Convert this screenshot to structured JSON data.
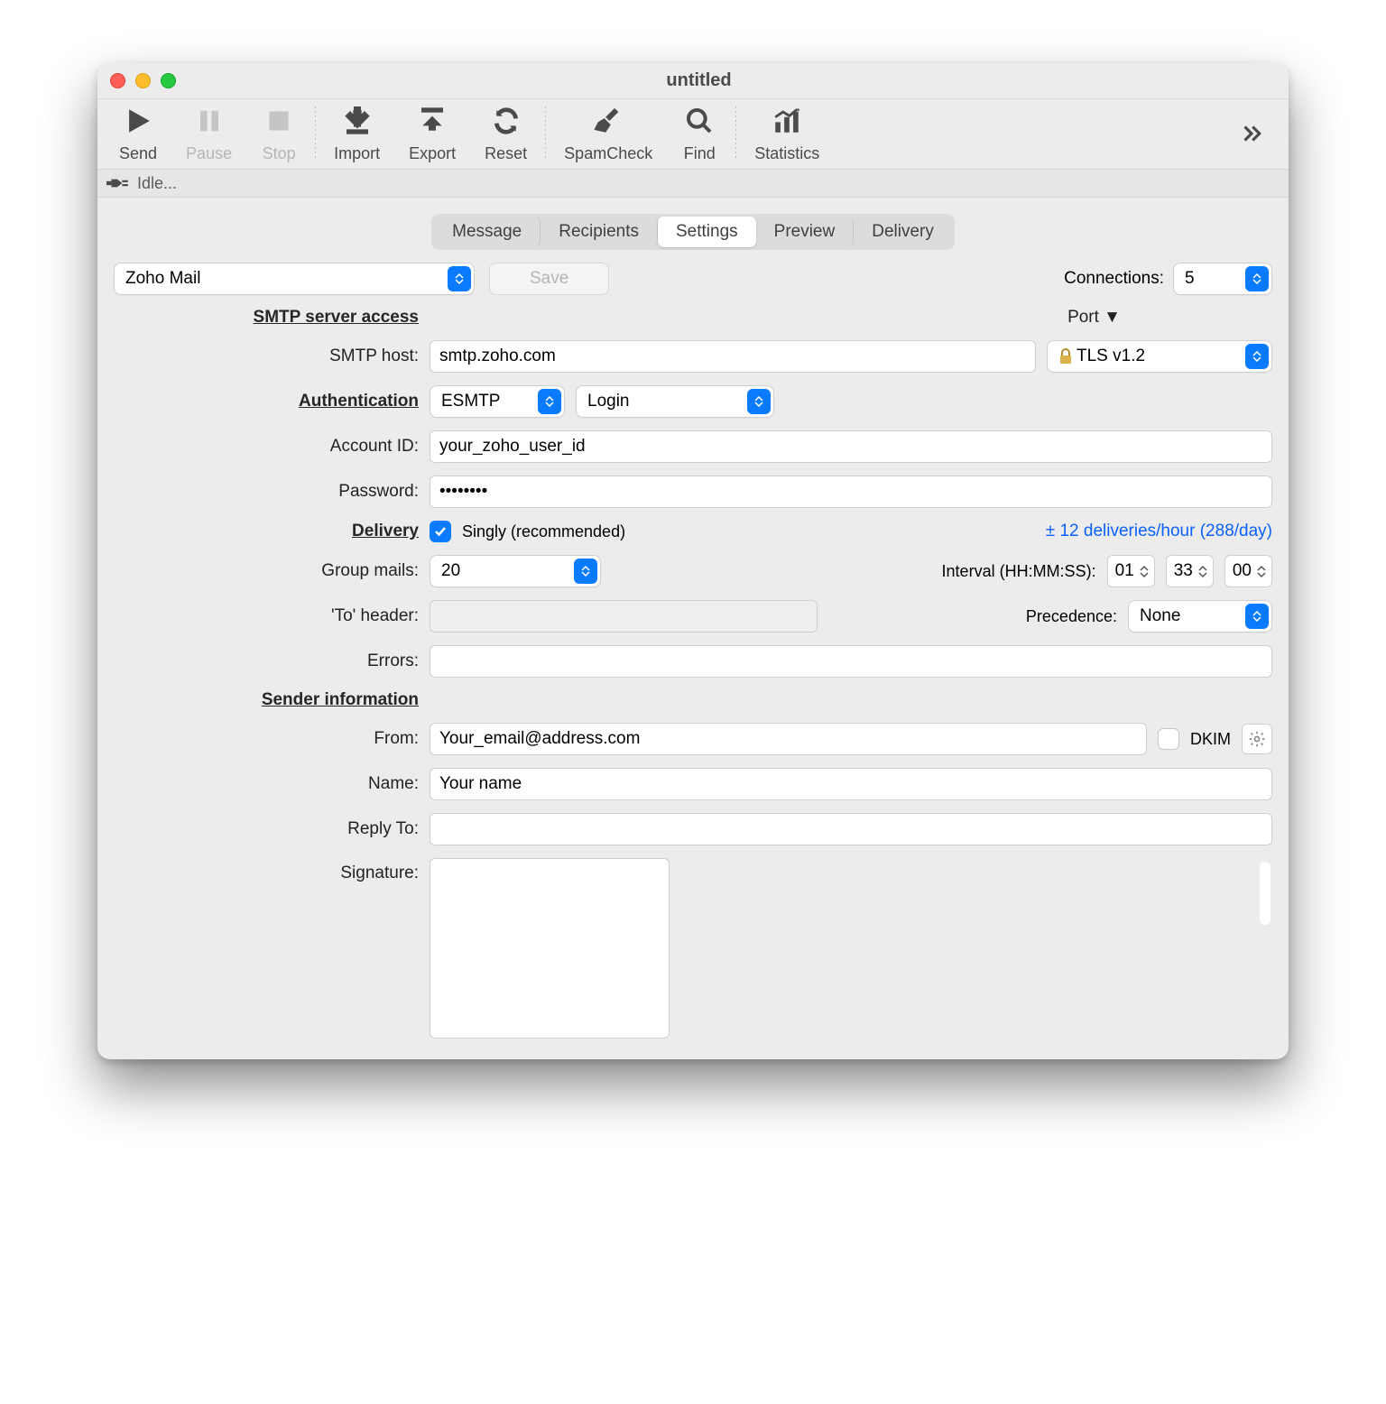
{
  "window": {
    "title": "untitled"
  },
  "toolbar": {
    "send": "Send",
    "pause": "Pause",
    "stop": "Stop",
    "import": "Import",
    "export": "Export",
    "reset": "Reset",
    "spamcheck": "SpamCheck",
    "find": "Find",
    "statistics": "Statistics"
  },
  "status": {
    "text": "Idle..."
  },
  "tabs": {
    "message": "Message",
    "recipients": "Recipients",
    "settings": "Settings",
    "preview": "Preview",
    "delivery": "Delivery"
  },
  "top": {
    "preset": "Zoho Mail",
    "save": "Save",
    "connections_label": "Connections:",
    "connections_value": "5"
  },
  "sections": {
    "smtp": "SMTP server access",
    "auth": "Authentication",
    "delivery": "Delivery",
    "sender": "Sender information"
  },
  "labels": {
    "smtp_host": "SMTP host:",
    "port": "Port ▼",
    "account_id": "Account ID:",
    "password": "Password:",
    "group_mails": "Group mails:",
    "interval": "Interval (HH:MM:SS):",
    "to_header": "'To' header:",
    "precedence": "Precedence:",
    "errors": "Errors:",
    "from": "From:",
    "dkim": "DKIM",
    "name": "Name:",
    "reply_to": "Reply To:",
    "signature": "Signature:"
  },
  "values": {
    "smtp_host": "smtp.zoho.com",
    "tls": "TLS v1.2",
    "auth_method": "ESMTP",
    "auth_type": "Login",
    "account_id": "your_zoho_user_id",
    "password": "••••••••",
    "singly": "Singly (recommended)",
    "rate": "± 12 deliveries/hour (288/day)",
    "group_mails": "20",
    "hh": "01",
    "mm": "33",
    "ss": "00",
    "to_header": "",
    "precedence": "None",
    "errors": "",
    "from": "Your_email@address.com",
    "name": "Your name",
    "reply_to": "",
    "signature": ""
  }
}
